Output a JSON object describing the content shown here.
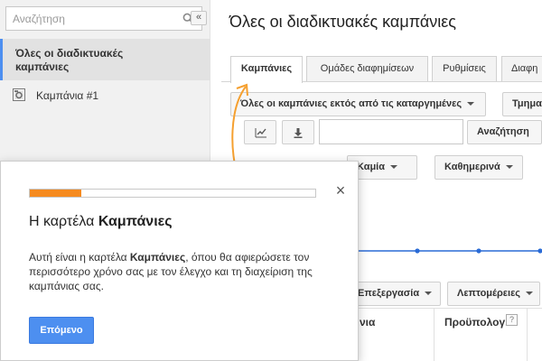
{
  "sidebar": {
    "search": {
      "placeholder": "Αναζήτηση"
    },
    "all_campaigns": "Όλες οι διαδικτυακές καμπάνιες",
    "collapse": "«",
    "campaigns": [
      {
        "label": "Καμπάνια #1"
      }
    ]
  },
  "main": {
    "title": "Όλες οι διαδικτυακές καμπάνιες",
    "tabs": [
      {
        "label": "Καμπάνιες"
      },
      {
        "label": "Ομάδες διαφημίσεων"
      },
      {
        "label": "Ρυθμίσεις"
      },
      {
        "label": "Διαφη"
      }
    ],
    "toolbar": {
      "filter_dropdown": "Όλες οι καμπάνιες εκτός από τις καταργημένες",
      "segment_dropdown": "Τμημα",
      "search_button": "Αναζήτηση",
      "none_dropdown": "Καμία",
      "daily_dropdown": "Καθημερινά",
      "edit_dropdown": "Επεξεργασία",
      "details_dropdown": "Λεπτομέρειες"
    },
    "table": {
      "columns": [
        "νια",
        "Προϋπολογ."
      ],
      "help": "?"
    }
  },
  "popup": {
    "progress_percent": 18,
    "close": "×",
    "title_prefix": "Η καρτέλα ",
    "title_bold": "Καμπάνιες",
    "body_1": "Αυτή είναι η καρτέλα ",
    "body_bold": "Καμπάνιες",
    "body_2": ", όπου θα αφιερώσετε τον περισσότερο χρόνο σας με τον έλεγχο και τη διαχείριση της καμπάνιας σας.",
    "next_button": "Επόμενο"
  },
  "colors": {
    "accent": "#4d8ff0",
    "progress": "#f58a1f",
    "chart_line": "#2a6bd6"
  }
}
